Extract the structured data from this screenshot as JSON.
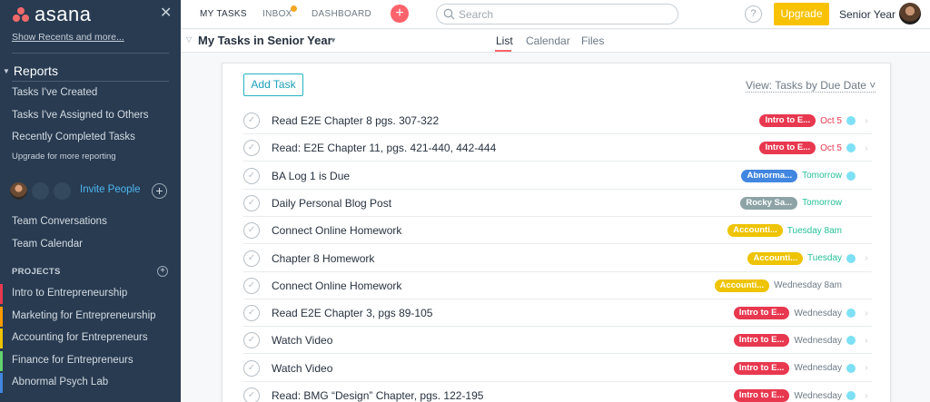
{
  "sidebar": {
    "logo_text": "asana",
    "close_glyph": "✕",
    "show_recents": "Show Recents and more...",
    "reports_heading": "Reports",
    "reports_items": [
      "Tasks I've Created",
      "Tasks I've Assigned to Others",
      "Recently Completed Tasks"
    ],
    "upgrade_note": "Upgrade for more reporting",
    "invite_label": "Invite People",
    "team_items": [
      "Team Conversations",
      "Team Calendar"
    ],
    "projects_heading": "PROJECTS",
    "projects": [
      {
        "label": "Intro to Entrepreneurship",
        "color": "#e8384f"
      },
      {
        "label": "Marketing for Entrepreneurship",
        "color": "#fd9a00"
      },
      {
        "label": "Accounting for Entrepreneurs",
        "color": "#eec300"
      },
      {
        "label": "Finance for Entrepreneurs",
        "color": "#62d26f"
      },
      {
        "label": "Abnormal Psych Lab",
        "color": "#4186e0"
      }
    ]
  },
  "topbar": {
    "nav": [
      "MY TASKS",
      "INBOX",
      "DASHBOARD"
    ],
    "search_placeholder": "Search",
    "help_glyph": "?",
    "upgrade_label": "Upgrade",
    "workspace": "Senior Year",
    "add_glyph": "+"
  },
  "subheader": {
    "title": "My Tasks in Senior Year",
    "tabs": [
      "List",
      "Calendar",
      "Files"
    ],
    "active_tab": "List"
  },
  "panel": {
    "add_task_label": "Add Task",
    "view_label": "View: Tasks by Due Date ˅"
  },
  "tasks": [
    {
      "name": "Read E2E Chapter 8 pgs. 307-322",
      "tag": "Intro to E...",
      "tag_color": "#e8384f",
      "due": "Oct 5",
      "due_tone": "red",
      "dot": true,
      "chevron": true
    },
    {
      "name": "Read: E2E Chapter 11, pgs. 421-440, 442-444",
      "tag": "Intro to E...",
      "tag_color": "#e8384f",
      "due": "Oct 5",
      "due_tone": "red",
      "dot": true,
      "chevron": true
    },
    {
      "name": "BA Log 1 is Due",
      "tag": "Abnorma...",
      "tag_color": "#4186e0",
      "due": "Tomorrow",
      "due_tone": "green",
      "dot": true,
      "chevron": false
    },
    {
      "name": "Daily Personal Blog Post",
      "tag": "Rocky Sa...",
      "tag_color": "#8da3a6",
      "due": "Tomorrow",
      "due_tone": "green",
      "dot": false,
      "chevron": false
    },
    {
      "name": "Connect Online Homework",
      "tag": "Accounti...",
      "tag_color": "#eec300",
      "due": "Tuesday 8am",
      "due_tone": "green",
      "dot": false,
      "chevron": false
    },
    {
      "name": "Chapter 8 Homework",
      "tag": "Accounti...",
      "tag_color": "#eec300",
      "due": "Tuesday",
      "due_tone": "green",
      "dot": true,
      "chevron": true
    },
    {
      "name": "Connect Online Homework",
      "tag": "Accounti...",
      "tag_color": "#eec300",
      "due": "Wednesday 8am",
      "due_tone": "gray",
      "dot": false,
      "chevron": false
    },
    {
      "name": "Read E2E Chapter 3, pgs 89-105",
      "tag": "Intro to E...",
      "tag_color": "#e8384f",
      "due": "Wednesday",
      "due_tone": "gray",
      "dot": true,
      "chevron": true
    },
    {
      "name": "Watch Video",
      "tag": "Intro to E...",
      "tag_color": "#e8384f",
      "due": "Wednesday",
      "due_tone": "gray",
      "dot": true,
      "chevron": true
    },
    {
      "name": "Watch Video",
      "tag": "Intro to E...",
      "tag_color": "#e8384f",
      "due": "Wednesday",
      "due_tone": "gray",
      "dot": true,
      "chevron": true
    },
    {
      "name": "Read: BMG “Design” Chapter, pgs. 122-195",
      "tag": "Intro to E...",
      "tag_color": "#e8384f",
      "due": "Wednesday",
      "due_tone": "gray",
      "dot": true,
      "chevron": true
    }
  ],
  "colors": {
    "sidebar_bg": "#283b51",
    "accent_red": "#fc636b",
    "upgrade": "#f8c200",
    "link_teal": "#26b3c5",
    "due_soon_green": "#25c098",
    "overdue_red": "#e8384f",
    "calendar_dot": "#7ee0f5"
  }
}
